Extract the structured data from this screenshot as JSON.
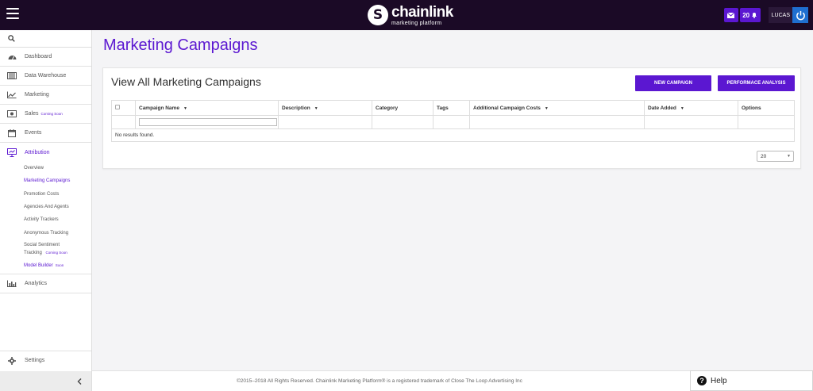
{
  "topbar": {
    "logo_name": "chainlink",
    "logo_sub": "marketing platform",
    "notification_count": "20",
    "user_name": "LUCAS",
    "logo_mark": "S"
  },
  "sidebar": {
    "items": [
      {
        "label": "Dashboard",
        "icon": "dashboard-gauge-icon"
      },
      {
        "label": "Data Warehouse",
        "icon": "warehouse-icon"
      },
      {
        "label": "Marketing",
        "icon": "line-chart-icon"
      },
      {
        "label": "Sales",
        "icon": "money-icon",
        "badge": "Coming Soon"
      },
      {
        "label": "Events",
        "icon": "calendar-icon"
      },
      {
        "label": "Attribution",
        "icon": "presentation-icon"
      },
      {
        "label": "Analytics",
        "icon": "bar-chart-icon"
      }
    ],
    "attribution_sub": [
      {
        "label": "Overview"
      },
      {
        "label": "Marketing Campaigns"
      },
      {
        "label": "Promotion Costs"
      },
      {
        "label": "Agencies And Agents"
      },
      {
        "label": "Activity Trackers"
      },
      {
        "label": "Anonymous Tracking"
      },
      {
        "label": "Social Sentiment Tracking",
        "badge": "Coming Soon"
      },
      {
        "label": "Model Builder",
        "badge": "Soon"
      }
    ],
    "settings_label": "Settings"
  },
  "main": {
    "page_title": "Marketing Campaigns",
    "panel_title": "View All Marketing Campaigns",
    "new_campaign_label": "NEW CAMPAIGN",
    "performance_label": "PERFORMACE ANALYSIS",
    "columns": [
      "Campaign Name",
      "Description",
      "Category",
      "Tags",
      "Additional Campaign Costs",
      "Date Added",
      "Options"
    ],
    "no_results": "No results found.",
    "page_size": "20"
  },
  "footer": {
    "copyright": "©2015–2018 All Rights Reserved. Chainlink Marketing Platform® is a registered trademark of Close The Loop Advertising Inc"
  },
  "help": {
    "label": "Help"
  },
  "colors": {
    "accent": "#5b17d1",
    "topbar_bg": "#1b0a26"
  }
}
